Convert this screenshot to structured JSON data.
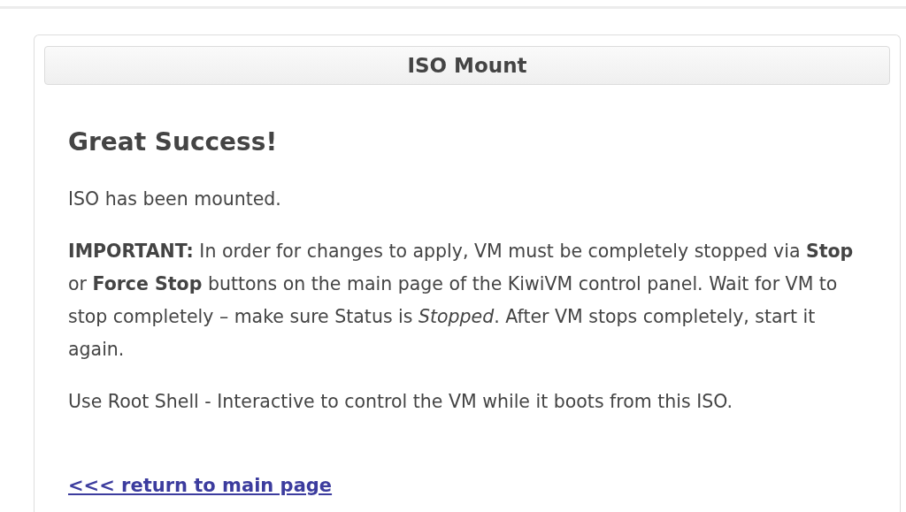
{
  "panel": {
    "title": "ISO Mount"
  },
  "message": {
    "heading": "Great Success!",
    "paragraphs": [
      "ISO has been mounted.",
      "**IMPORTANT:** In order for changes to apply, VM must be completely stopped via **Stop** or **Force Stop** buttons on the main page of the KiwiVM control panel. Wait for VM to stop completely – make sure Status is *Stopped*. After VM stops completely, start it again.",
      "Use Root Shell - Interactive to control the VM while it boots from this ISO."
    ]
  },
  "link": "<<< return to main page"
}
